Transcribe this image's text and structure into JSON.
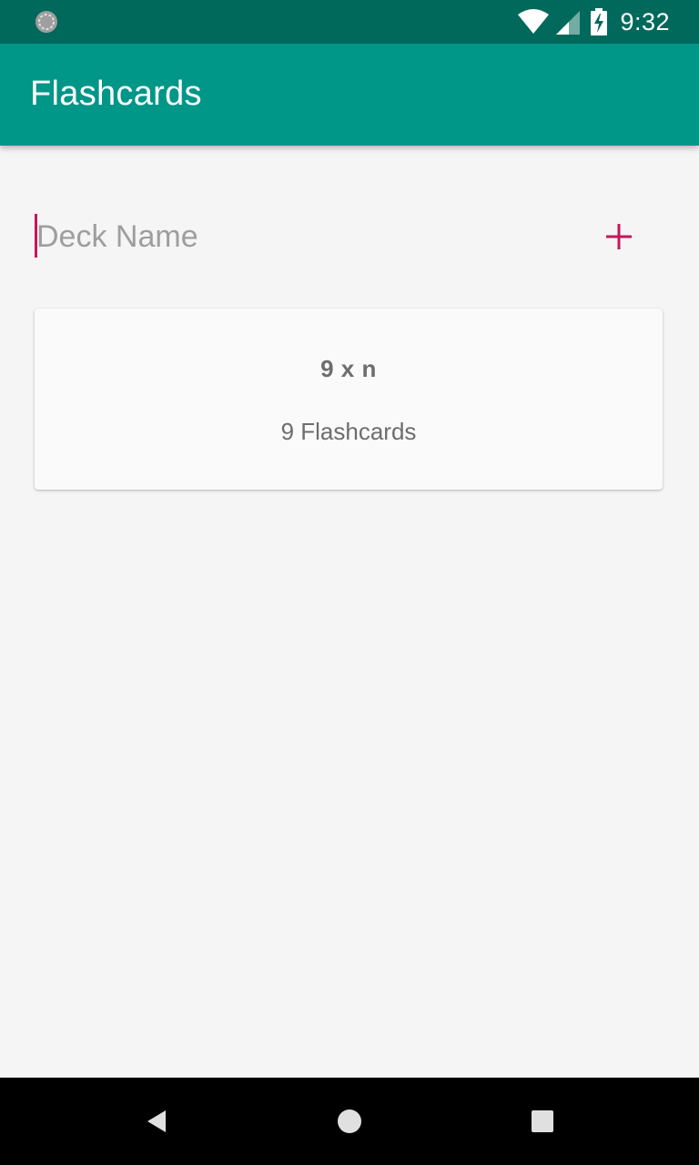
{
  "status_bar": {
    "time": "9:32",
    "icons": [
      "sync-circle-icon",
      "wifi-icon",
      "cell-signal-icon",
      "battery-charging-icon"
    ]
  },
  "app_bar": {
    "title": "Flashcards"
  },
  "deck_form": {
    "value": "",
    "placeholder": "Deck Name",
    "add_icon": "plus-icon"
  },
  "decks": [
    {
      "name": "9 x n",
      "count_label": "9 Flashcards"
    }
  ],
  "nav_bar": {
    "icons": [
      "back-triangle-icon",
      "home-circle-icon",
      "recents-square-icon"
    ]
  },
  "colors": {
    "status_bar": "#00695c",
    "app_bar": "#009688",
    "accent": "#c2185b",
    "background": "#f5f5f5"
  }
}
